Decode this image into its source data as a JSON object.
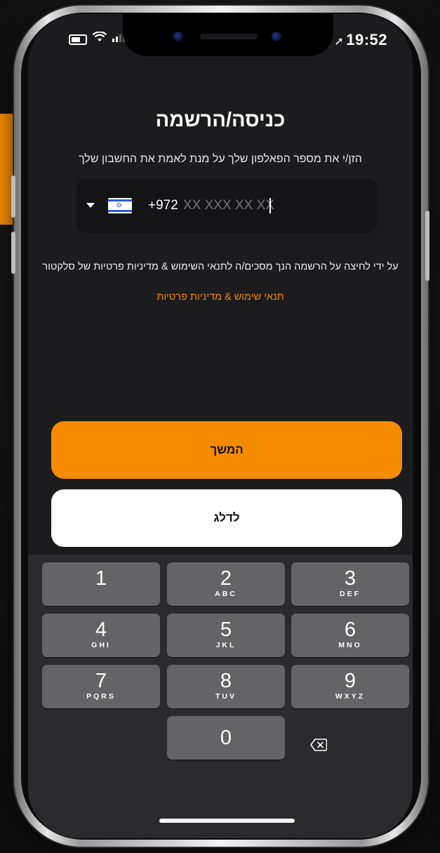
{
  "status_bar": {
    "time": "19:52",
    "location_icon": "location-arrow-icon"
  },
  "title": "כניסה/הרשמה",
  "subtitle": "הזן/י את מספר הפאלפון שלך על מנת לאמת את החשבון שלך",
  "phone": {
    "country_flag": "israel-flag-icon",
    "dial_code": "+972",
    "placeholder": "XX XXX XX XX"
  },
  "terms": {
    "text": "על ידי לחיצה על הרשמה הנך מסכים/ה לתנאי השימוש & מדיניות  פרטיות של סלקטור",
    "link": "תנאי שימוש & מדיניות פרטיות"
  },
  "buttons": {
    "continue": "המשך",
    "skip": "לדלג"
  },
  "keypad": [
    {
      "digit": "1",
      "letters": ""
    },
    {
      "digit": "2",
      "letters": "ABC"
    },
    {
      "digit": "3",
      "letters": "DEF"
    },
    {
      "digit": "4",
      "letters": "GHI"
    },
    {
      "digit": "5",
      "letters": "JKL"
    },
    {
      "digit": "6",
      "letters": "MNO"
    },
    {
      "digit": "7",
      "letters": "PQRS"
    },
    {
      "digit": "8",
      "letters": "TUV"
    },
    {
      "digit": "9",
      "letters": "WXYZ"
    },
    {
      "digit": "0",
      "letters": ""
    }
  ],
  "colors": {
    "accent": "#f58b00",
    "background": "#1c1c1e",
    "keypad": "#2b2b2d",
    "key": "#646466"
  }
}
